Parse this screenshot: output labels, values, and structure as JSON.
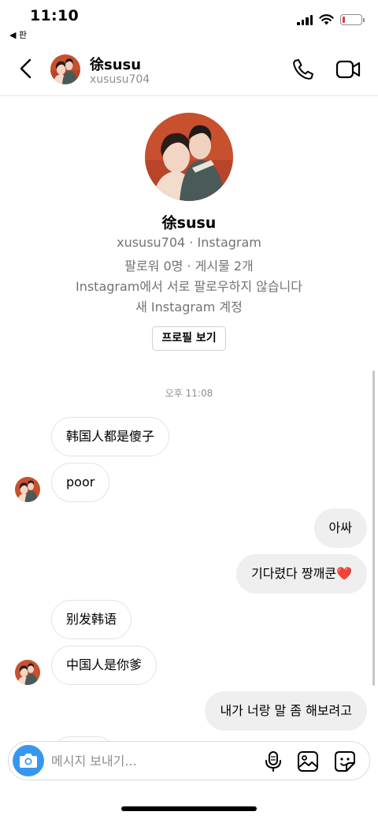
{
  "status_bar": {
    "time": "11:10",
    "back_app": "◀ 판",
    "battery_level": 0.12,
    "battery_color": "#e53935"
  },
  "header": {
    "name": "徐susu",
    "username": "xususu704",
    "icons": [
      "back-icon",
      "phone-icon",
      "video-icon"
    ]
  },
  "profile": {
    "name": "徐susu",
    "line1": "xususu704 · Instagram",
    "line2": "팔로워 0명 · 게시물 2개",
    "line3": "Instagram에서 서로 팔로우하지 않습니다",
    "line4": "새 Instagram 계정",
    "view_button": "프로필 보기"
  },
  "timestamp": "오후 11:08",
  "messages": [
    {
      "text": "韩国人都是傻子",
      "direction": "incoming"
    },
    {
      "text": "poor",
      "direction": "incoming"
    },
    {
      "text": "아싸",
      "direction": "outgoing"
    },
    {
      "text": "기다렸다 짱깨쿤",
      "emoji": "❤️",
      "direction": "outgoing"
    },
    {
      "text": "别发韩语",
      "direction": "incoming"
    },
    {
      "text": "中国人是你爹",
      "direction": "incoming"
    },
    {
      "text": "내가 너랑 말 좀 해보려고",
      "direction": "outgoing"
    }
  ],
  "composer": {
    "placeholder": "메시지 보내기...",
    "icons": [
      "camera-icon",
      "microphone-icon",
      "gallery-icon",
      "sticker-icon"
    ]
  },
  "colors": {
    "accent": "#3797f0",
    "outgoing_bubble": "#efefef",
    "secondary_text": "#737373"
  }
}
